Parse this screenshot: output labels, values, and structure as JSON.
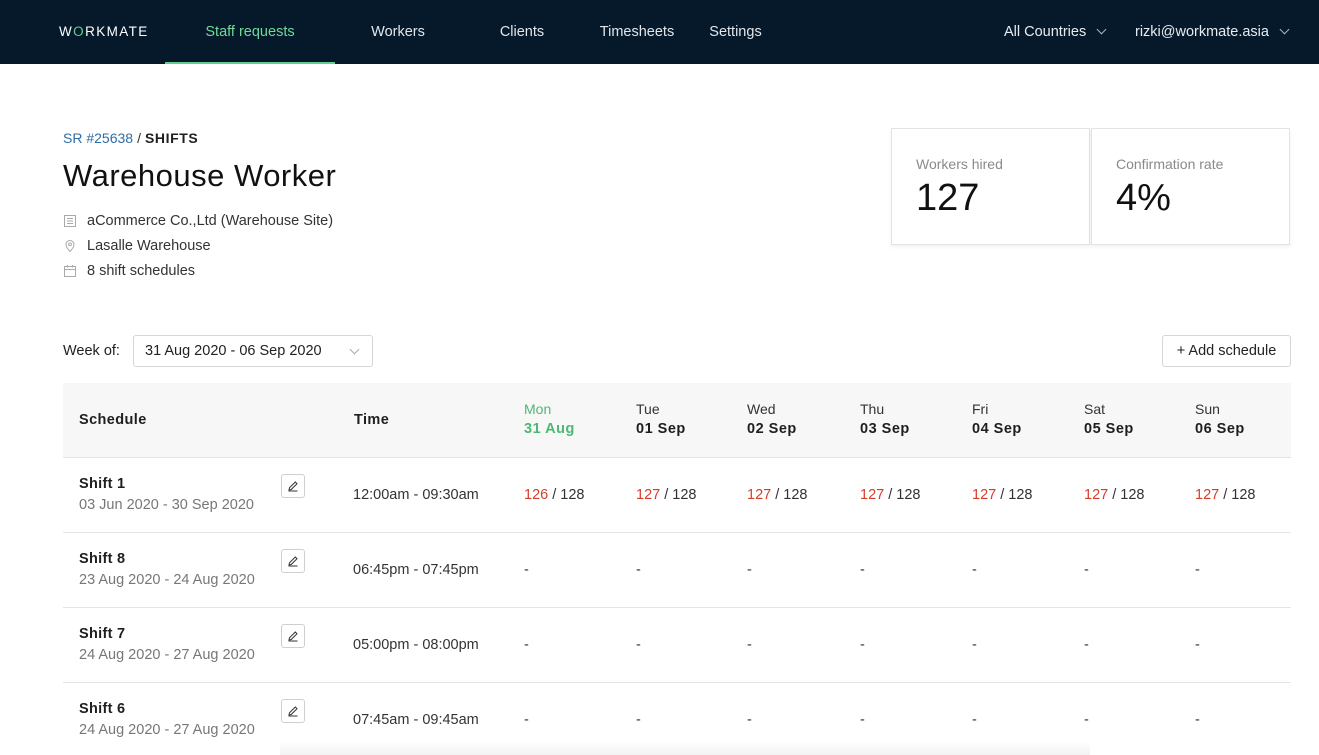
{
  "app": {
    "logo": "WORKMATE",
    "nav": [
      "Staff requests",
      "Workers",
      "Clients",
      "Timesheets",
      "Settings"
    ],
    "active_nav": "Staff requests",
    "country": "All Countries",
    "user": "rizki@workmate.asia",
    "accent": "#5fd08f",
    "nav_bg": "#06192b"
  },
  "breadcrumb": {
    "parent": "SR #25638",
    "separator": "/",
    "current": "SHIFTS"
  },
  "page": {
    "title": "Warehouse Worker",
    "client": "aCommerce Co.,Ltd (Warehouse Site)",
    "location": "Lasalle Warehouse",
    "schedules": "8 shift schedules"
  },
  "stats": [
    {
      "label": "Workers hired",
      "value": "127"
    },
    {
      "label": "Confirmation rate",
      "value": "4%"
    }
  ],
  "week": {
    "label": "Week of:",
    "value": "31 Aug 2020 - 06 Sep 2020",
    "add_button": "+ Add schedule"
  },
  "table": {
    "headers": {
      "schedule": "Schedule",
      "time": "Time"
    },
    "days": [
      {
        "name": "Mon",
        "date": "31 Aug",
        "today": true
      },
      {
        "name": "Tue",
        "date": "01 Sep"
      },
      {
        "name": "Wed",
        "date": "02 Sep"
      },
      {
        "name": "Thu",
        "date": "03 Sep"
      },
      {
        "name": "Fri",
        "date": "04 Sep"
      },
      {
        "name": "Sat",
        "date": "05 Sep"
      },
      {
        "name": "Sun",
        "date": "06 Sep"
      }
    ],
    "rows": [
      {
        "name": "Shift 1",
        "range": "03 Jun 2020 - 30 Sep 2020",
        "time": "12:00am - 09:30am",
        "cells": [
          {
            "filled": "126",
            "total": "128"
          },
          {
            "filled": "127",
            "total": "128"
          },
          {
            "filled": "127",
            "total": "128"
          },
          {
            "filled": "127",
            "total": "128"
          },
          {
            "filled": "127",
            "total": "128"
          },
          {
            "filled": "127",
            "total": "128"
          },
          {
            "filled": "127",
            "total": "128"
          }
        ]
      },
      {
        "name": "Shift 8",
        "range": "23 Aug 2020 - 24 Aug 2020",
        "time": "06:45pm - 07:45pm",
        "cells": [
          "-",
          "-",
          "-",
          "-",
          "-",
          "-",
          "-"
        ]
      },
      {
        "name": "Shift 7",
        "range": "24 Aug 2020 - 27 Aug 2020",
        "time": "05:00pm - 08:00pm",
        "cells": [
          "-",
          "-",
          "-",
          "-",
          "-",
          "-",
          "-"
        ]
      },
      {
        "name": "Shift 6",
        "range": "24 Aug 2020 - 27 Aug 2020",
        "time": "07:45am - 09:45am",
        "cells": [
          "-",
          "-",
          "-",
          "-",
          "-",
          "-",
          "-"
        ]
      }
    ],
    "highlight_color": "#d23f2a",
    "today_color": "#4db873"
  }
}
